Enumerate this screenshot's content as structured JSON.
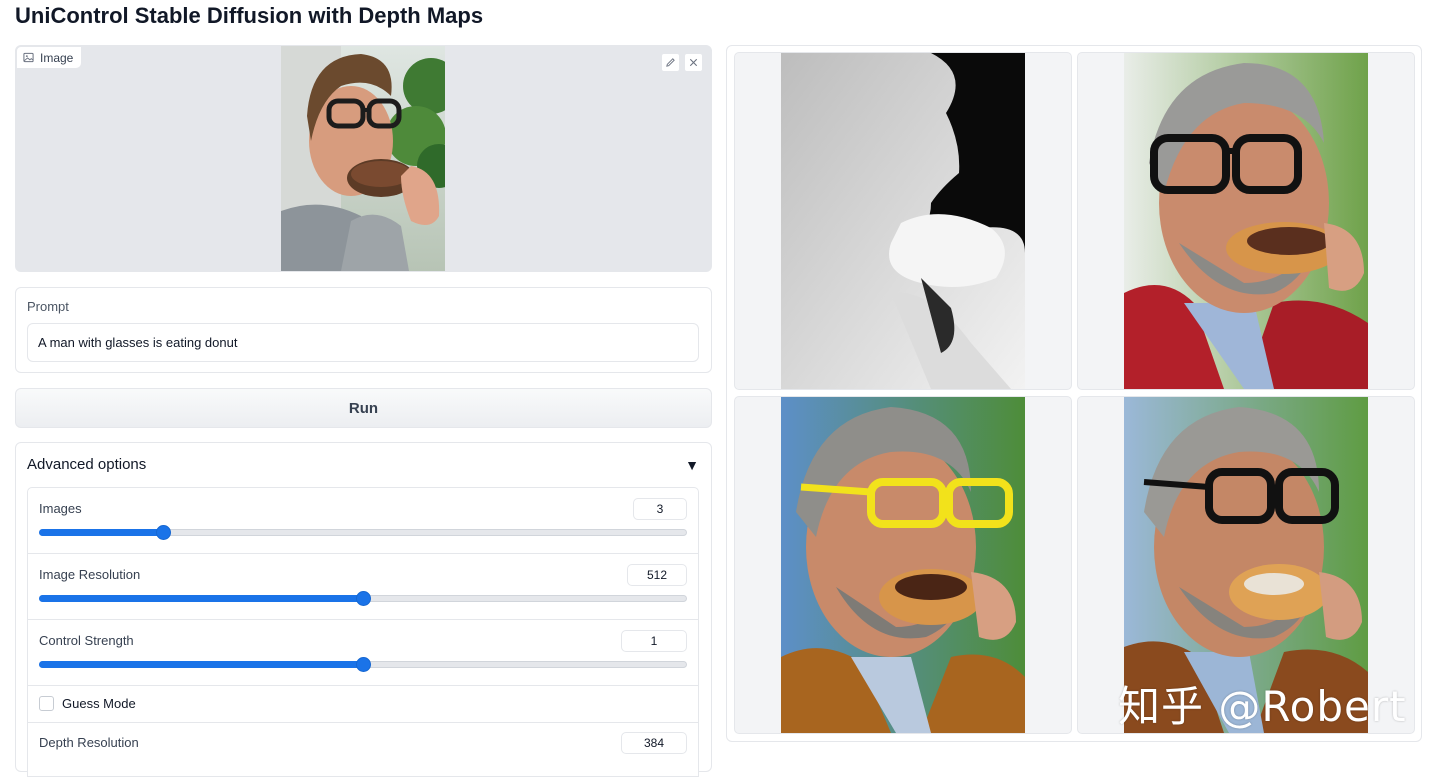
{
  "page": {
    "title": "UniControl Stable Diffusion with Depth Maps"
  },
  "image_input": {
    "label": "Image",
    "icon": "image-icon",
    "edit_icon": "pencil-icon",
    "clear_icon": "close-icon"
  },
  "prompt": {
    "label": "Prompt",
    "value": "A man with glasses is eating donut"
  },
  "run_button": {
    "label": "Run"
  },
  "advanced": {
    "title": "Advanced options",
    "toggle_glyph": "▼",
    "sliders": [
      {
        "label": "Images",
        "value": "3",
        "fraction": 0.19
      },
      {
        "label": "Image Resolution",
        "value": "512",
        "fraction": 0.5
      },
      {
        "label": "Control Strength",
        "value": "1",
        "fraction": 0.5
      }
    ],
    "guess_mode": {
      "label": "Guess Mode",
      "checked": false
    },
    "depth_resolution": {
      "label": "Depth Resolution",
      "value": "384"
    }
  },
  "gallery": {
    "items": [
      "depth-map-image",
      "generated-image-1",
      "generated-image-2",
      "generated-image-3"
    ]
  },
  "watermark": "知乎 @Robert",
  "colors": {
    "accent": "#1a73e8",
    "panel_bg": "#e5e7eb",
    "border": "#e5e7eb"
  }
}
